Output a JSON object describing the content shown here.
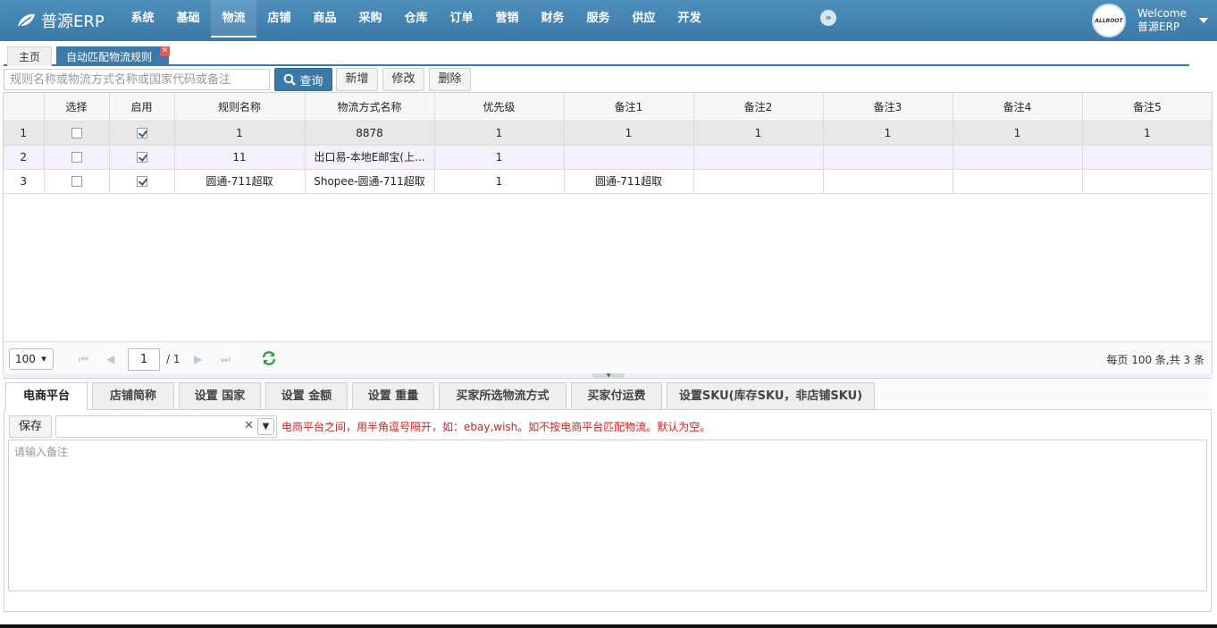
{
  "app": {
    "brand": "普源ERP"
  },
  "nav": {
    "items": [
      "系统",
      "基础",
      "物流",
      "店铺",
      "商品",
      "采购",
      "仓库",
      "订单",
      "营销",
      "财务",
      "服务",
      "供应",
      "开发"
    ],
    "active_index": 2
  },
  "user": {
    "welcome": "Welcome",
    "name": "普源ERP",
    "avatar_text": "ALLROOT"
  },
  "tabs": {
    "home": "主页",
    "current": "自动匹配物流规则"
  },
  "toolbar": {
    "search_placeholder": "规则名称或物流方式名称或国家代码或备注",
    "query": "查询",
    "add": "新增",
    "edit": "修改",
    "delete": "删除"
  },
  "grid": {
    "columns": [
      "",
      "选择",
      "启用",
      "规则名称",
      "物流方式名称",
      "优先级",
      "备注1",
      "备注2",
      "备注3",
      "备注4",
      "备注5"
    ],
    "rows": [
      {
        "no": "1",
        "selected": false,
        "enabled": true,
        "rule_name": "1",
        "method": "8878",
        "priority": "1",
        "note1": "1",
        "note2": "1",
        "note3": "1",
        "note4": "1",
        "note5": "1"
      },
      {
        "no": "2",
        "selected": false,
        "enabled": true,
        "rule_name": "11",
        "method": "出口易-本地E邮宝(上...",
        "priority": "1",
        "note1": "",
        "note2": "",
        "note3": "",
        "note4": "",
        "note5": ""
      },
      {
        "no": "3",
        "selected": false,
        "enabled": true,
        "rule_name": "圆通-711超取",
        "method": "Shopee-圆通-711超取",
        "priority": "1",
        "note1": "圆通-711超取",
        "note2": "",
        "note3": "",
        "note4": "",
        "note5": ""
      }
    ]
  },
  "pager": {
    "page_size": "100",
    "page": "1",
    "total_pages": "/ 1",
    "info": "每页 100 条,共 3 条"
  },
  "detail": {
    "tabs": [
      "电商平台",
      "店铺简称",
      "设置 国家",
      "设置 金额",
      "设置 重量",
      "买家所选物流方式",
      "买家付运费",
      "设置SKU(库存SKU，非店铺SKU)"
    ],
    "active_tab": 0,
    "save": "保存",
    "hint": "电商平台之间，用半角逗号隔开，如：ebay,wish。如不按电商平台匹配物流。默认为空。",
    "note_placeholder": "请输入备注"
  },
  "colors": {
    "primary": "#3a79a8",
    "hint_red": "#d62020"
  }
}
